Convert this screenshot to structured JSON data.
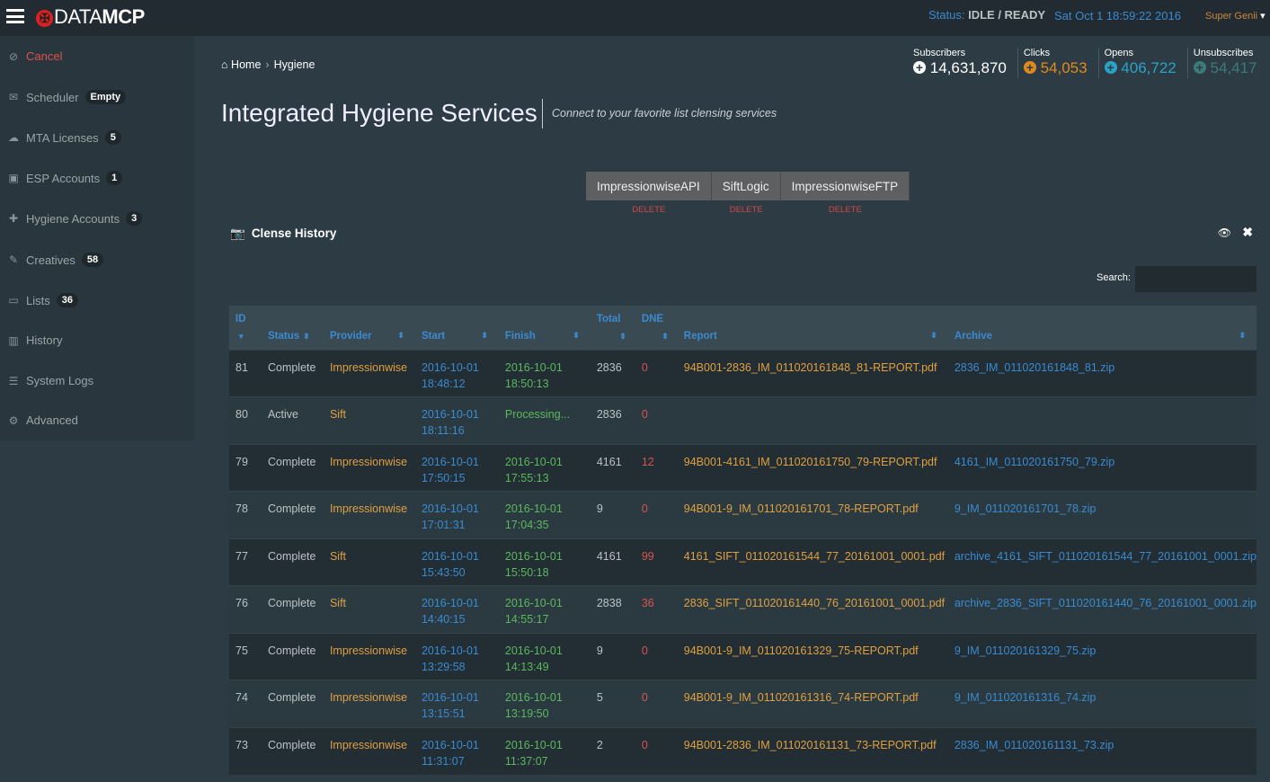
{
  "header": {
    "logo": "DATA MCP",
    "logo_a": "DATA",
    "logo_b": "MCP",
    "status_label": "Status:",
    "status_value": "IDLE / READY",
    "datetime": "Sat Oct 1 18:59:22 2016",
    "user": "Super Genii"
  },
  "sidebar": {
    "items": [
      {
        "label": "Cancel",
        "icon": "ban-icon",
        "badge": null
      },
      {
        "label": "Scheduler",
        "icon": "envelope-icon",
        "badge": "Empty"
      },
      {
        "label": "MTA Licenses",
        "icon": "cloud-icon",
        "badge": "5"
      },
      {
        "label": "ESP Accounts",
        "icon": "inbox-icon",
        "badge": "1"
      },
      {
        "label": "Hygiene Accounts",
        "icon": "medkit-icon",
        "badge": "3"
      },
      {
        "label": "Creatives",
        "icon": "edit-icon",
        "badge": "58"
      },
      {
        "label": "Lists",
        "icon": "folder-icon",
        "badge": "36"
      },
      {
        "label": "History",
        "icon": "bar-chart-icon",
        "badge": null
      },
      {
        "label": "System Logs",
        "icon": "list-icon",
        "badge": null
      },
      {
        "label": "Advanced",
        "icon": "cogs-icon",
        "badge": null
      }
    ]
  },
  "breadcrumb": {
    "home": "Home",
    "current": "Hygiene"
  },
  "page": {
    "title": "Integrated Hygiene Services",
    "subtitle": "Connect to your favorite list clensing services"
  },
  "stats": [
    {
      "label": "Subscribers",
      "value": "14,631,870",
      "color": "#ffffff"
    },
    {
      "label": "Clicks",
      "value": "54,053",
      "color": "#e08a1e"
    },
    {
      "label": "Opens",
      "value": "406,722",
      "color": "#2aa3c9"
    },
    {
      "label": "Unsubscribes",
      "value": "54,417",
      "color": "#3d7a7a"
    }
  ],
  "providers": [
    {
      "label": "ImpressionwiseAPI",
      "delete": "DELETE"
    },
    {
      "label": "SiftLogic",
      "delete": "DELETE"
    },
    {
      "label": "ImpressionwiseFTP",
      "delete": "DELETE"
    }
  ],
  "panel": {
    "title": "Clense History",
    "search_label": "Search:",
    "search_value": ""
  },
  "table": {
    "columns": [
      "ID",
      "Status",
      "Provider",
      "Start",
      "Finish",
      "Total",
      "DNE",
      "Report",
      "Archive"
    ],
    "rows": [
      {
        "id": "81",
        "status": "Complete",
        "provider": "Impressionwise",
        "start": [
          "2016-10-01",
          "18:48:12"
        ],
        "finish": [
          "2016-10-01",
          "18:50:13"
        ],
        "total": "2836",
        "dne": "0",
        "report": "94B001-2836_IM_011020161848_81-REPORT.pdf",
        "archive": "2836_IM_011020161848_81.zip"
      },
      {
        "id": "80",
        "status": "Active",
        "provider": "Sift",
        "start": [
          "2016-10-01",
          "18:11:16"
        ],
        "finish": [
          "Processing...",
          ""
        ],
        "total": "2836",
        "dne": "0",
        "report": "",
        "archive": ""
      },
      {
        "id": "79",
        "status": "Complete",
        "provider": "Impressionwise",
        "start": [
          "2016-10-01",
          "17:50:15"
        ],
        "finish": [
          "2016-10-01",
          "17:55:13"
        ],
        "total": "4161",
        "dne": "12",
        "report": "94B001-4161_IM_011020161750_79-REPORT.pdf",
        "archive": "4161_IM_011020161750_79.zip"
      },
      {
        "id": "78",
        "status": "Complete",
        "provider": "Impressionwise",
        "start": [
          "2016-10-01",
          "17:01:31"
        ],
        "finish": [
          "2016-10-01",
          "17:04:35"
        ],
        "total": "9",
        "dne": "0",
        "report": "94B001-9_IM_011020161701_78-REPORT.pdf",
        "archive": "9_IM_011020161701_78.zip"
      },
      {
        "id": "77",
        "status": "Complete",
        "provider": "Sift",
        "start": [
          "2016-10-01",
          "15:43:50"
        ],
        "finish": [
          "2016-10-01",
          "15:50:18"
        ],
        "total": "4161",
        "dne": "99",
        "report": "4161_SIFT_011020161544_77_20161001_0001.pdf",
        "archive": "archive_4161_SIFT_011020161544_77_20161001_0001.zip"
      },
      {
        "id": "76",
        "status": "Complete",
        "provider": "Sift",
        "start": [
          "2016-10-01",
          "14:40:15"
        ],
        "finish": [
          "2016-10-01",
          "14:55:17"
        ],
        "total": "2838",
        "dne": "36",
        "report": "2836_SIFT_011020161440_76_20161001_0001.pdf",
        "archive": "archive_2836_SIFT_011020161440_76_20161001_0001.zip"
      },
      {
        "id": "75",
        "status": "Complete",
        "provider": "Impressionwise",
        "start": [
          "2016-10-01",
          "13:29:58"
        ],
        "finish": [
          "2016-10-01",
          "14:13:49"
        ],
        "total": "9",
        "dne": "0",
        "report": "94B001-9_IM_011020161329_75-REPORT.pdf",
        "archive": "9_IM_011020161329_75.zip"
      },
      {
        "id": "74",
        "status": "Complete",
        "provider": "Impressionwise",
        "start": [
          "2016-10-01",
          "13:15:51"
        ],
        "finish": [
          "2016-10-01",
          "13:19:50"
        ],
        "total": "5",
        "dne": "0",
        "report": "94B001-9_IM_011020161316_74-REPORT.pdf",
        "archive": "9_IM_011020161316_74.zip"
      },
      {
        "id": "73",
        "status": "Complete",
        "provider": "Impressionwise",
        "start": [
          "2016-10-01",
          "11:31:07"
        ],
        "finish": [
          "2016-10-01",
          "11:37:07"
        ],
        "total": "2",
        "dne": "0",
        "report": "94B001-2836_IM_011020161131_73-REPORT.pdf",
        "archive": "2836_IM_011020161131_73.zip"
      }
    ]
  }
}
